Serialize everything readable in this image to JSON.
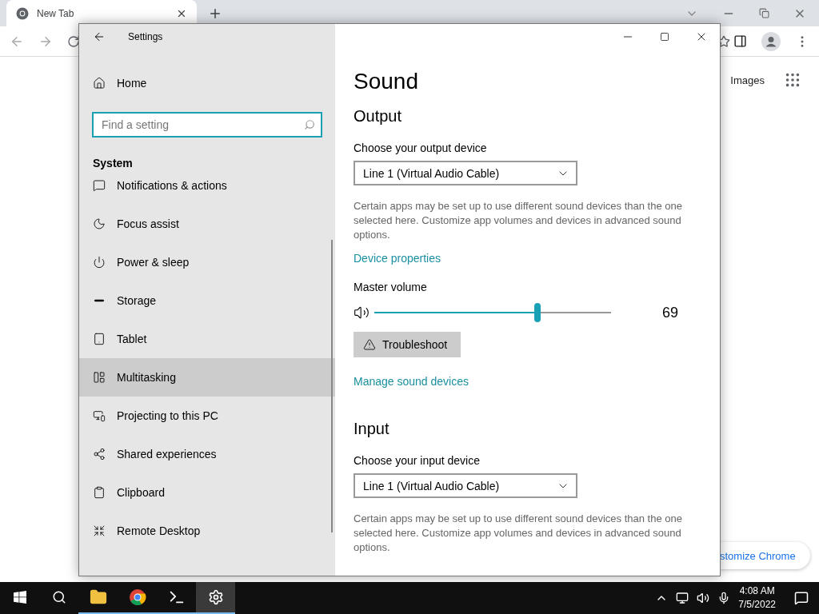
{
  "browser": {
    "tab": {
      "title": "New Tab"
    },
    "links": [
      "Images"
    ],
    "customize_button": "stomize Chrome"
  },
  "settings": {
    "title": "Settings",
    "home": "Home",
    "search": {
      "placeholder": "Find a setting"
    },
    "section": "System",
    "nav": [
      {
        "kind": "notifications",
        "label": "Notifications & actions",
        "selected": false
      },
      {
        "kind": "focus",
        "label": "Focus assist",
        "selected": false
      },
      {
        "kind": "power",
        "label": "Power & sleep",
        "selected": false
      },
      {
        "kind": "storage",
        "label": "Storage",
        "selected": false
      },
      {
        "kind": "tablet",
        "label": "Tablet",
        "selected": false
      },
      {
        "kind": "multitasking",
        "label": "Multitasking",
        "selected": true
      },
      {
        "kind": "projecting",
        "label": "Projecting to this PC",
        "selected": false
      },
      {
        "kind": "shared",
        "label": "Shared experiences",
        "selected": false
      },
      {
        "kind": "clipboard",
        "label": "Clipboard",
        "selected": false
      },
      {
        "kind": "remote",
        "label": "Remote Desktop",
        "selected": false
      }
    ],
    "page_title": "Sound",
    "output": {
      "heading": "Output",
      "device_label": "Choose your output device",
      "device_value": "Line 1 (Virtual Audio Cable)",
      "note": "Certain apps may be set up to use different sound devices than the one selected here. Customize app volumes and devices in advanced sound options.",
      "link": "Device properties"
    },
    "master_volume": {
      "label": "Master volume",
      "level": 0.69,
      "reading": "69"
    },
    "troubleshoot": "Troubleshoot",
    "manage_link": "Manage sound devices",
    "input": {
      "heading": "Input",
      "device_label": "Choose your input device",
      "device_value": "Line 1 (Virtual Audio Cable)",
      "note": "Certain apps may be set up to use different sound devices than the one selected here. Customize app volumes and devices in advanced sound options."
    }
  },
  "taskbar": {
    "apps": [
      {
        "kind": "start",
        "running": false,
        "selected": false
      },
      {
        "kind": "search",
        "running": false,
        "selected": false
      },
      {
        "kind": "explorer",
        "running": true,
        "selected": false
      },
      {
        "kind": "chrome",
        "running": true,
        "selected": false
      },
      {
        "kind": "terminal",
        "running": true,
        "selected": false
      },
      {
        "kind": "settings",
        "running": true,
        "selected": true
      }
    ],
    "time": "4:08 AM",
    "date": "7/5/2022"
  }
}
